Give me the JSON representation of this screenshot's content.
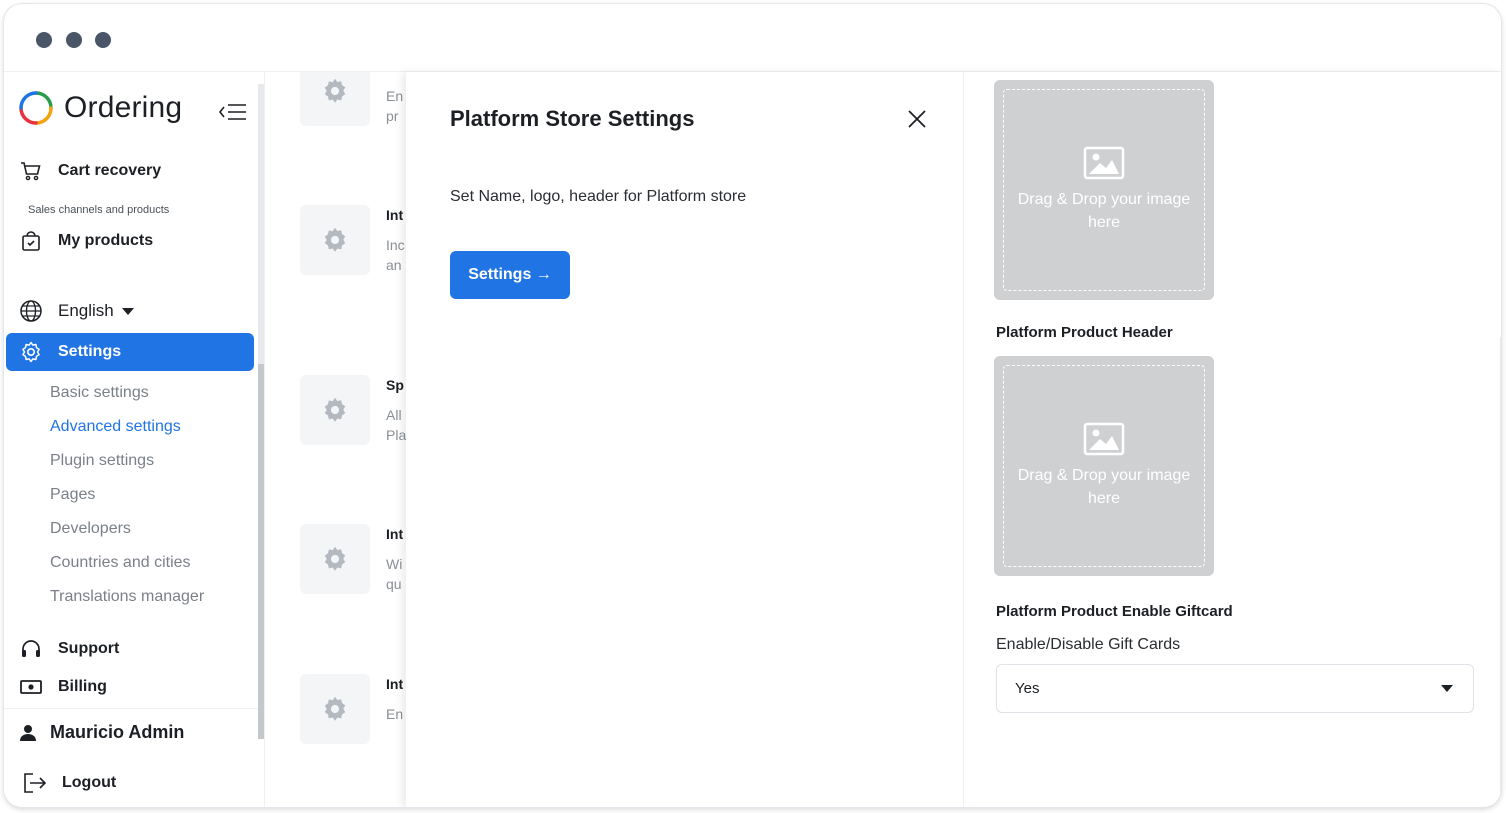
{
  "sidebar": {
    "logo": "Ordering",
    "section_label": "Sales channels and products",
    "items": {
      "cart_recovery": "Cart recovery",
      "my_products": "My products",
      "language": "English",
      "settings": "Settings",
      "support": "Support",
      "billing": "Billing"
    },
    "sub_items": [
      "Basic settings",
      "Advanced settings",
      "Plugin settings",
      "Pages",
      "Developers",
      "Countries and cities",
      "Translations manager"
    ],
    "active_sub_item": "Advanced settings",
    "user_name": "Mauricio Admin",
    "logout": "Logout"
  },
  "background_list": [
    {
      "title": "",
      "lines": [
        "En",
        "pr"
      ]
    },
    {
      "title": "Int",
      "lines": [
        "Inc",
        "an"
      ]
    },
    {
      "title": "Sp",
      "lines": [
        "All",
        "Pla"
      ]
    },
    {
      "title": "Int",
      "lines": [
        "Wi",
        "qu"
      ]
    },
    {
      "title": "Int",
      "lines": [
        "En"
      ]
    }
  ],
  "modal": {
    "title": "Platform Store Settings",
    "description": "Set Name, logo, header for Platform store",
    "settings_button": "Settings →",
    "drop_zone_text": "Drag & Drop your image here",
    "product_header_label": "Platform Product Header",
    "giftcard_label": "Platform Product Enable Giftcard",
    "giftcard_sub": "Enable/Disable Gift Cards",
    "giftcard_value": "Yes"
  },
  "colors": {
    "accent": "#2074e3",
    "drop_zone": "#cfd0d2"
  }
}
